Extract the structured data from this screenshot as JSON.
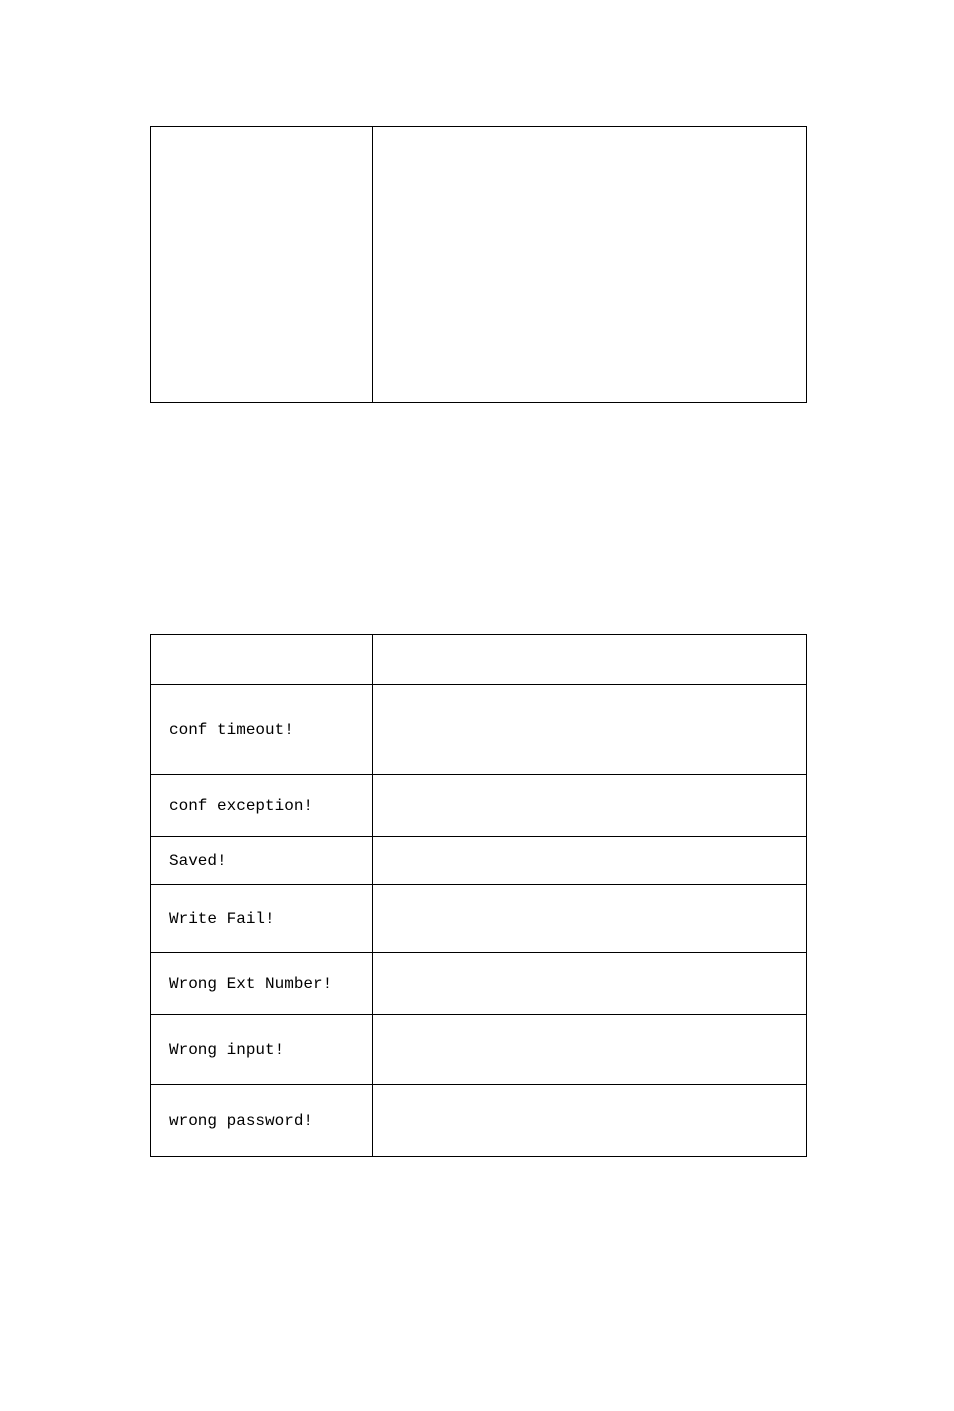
{
  "table1": {
    "rows": [
      {
        "col1": "",
        "col2": ""
      }
    ]
  },
  "table2": {
    "header": {
      "col1": "",
      "col2": ""
    },
    "rows": [
      {
        "col1": "conf timeout!",
        "col2": ""
      },
      {
        "col1": "conf exception!",
        "col2": ""
      },
      {
        "col1": "Saved!",
        "col2": ""
      },
      {
        "col1": "Write Fail!",
        "col2": ""
      },
      {
        "col1": "Wrong Ext Number!",
        "col2": ""
      },
      {
        "col1": "Wrong input!",
        "col2": ""
      },
      {
        "col1": "wrong password!",
        "col2": ""
      }
    ]
  }
}
